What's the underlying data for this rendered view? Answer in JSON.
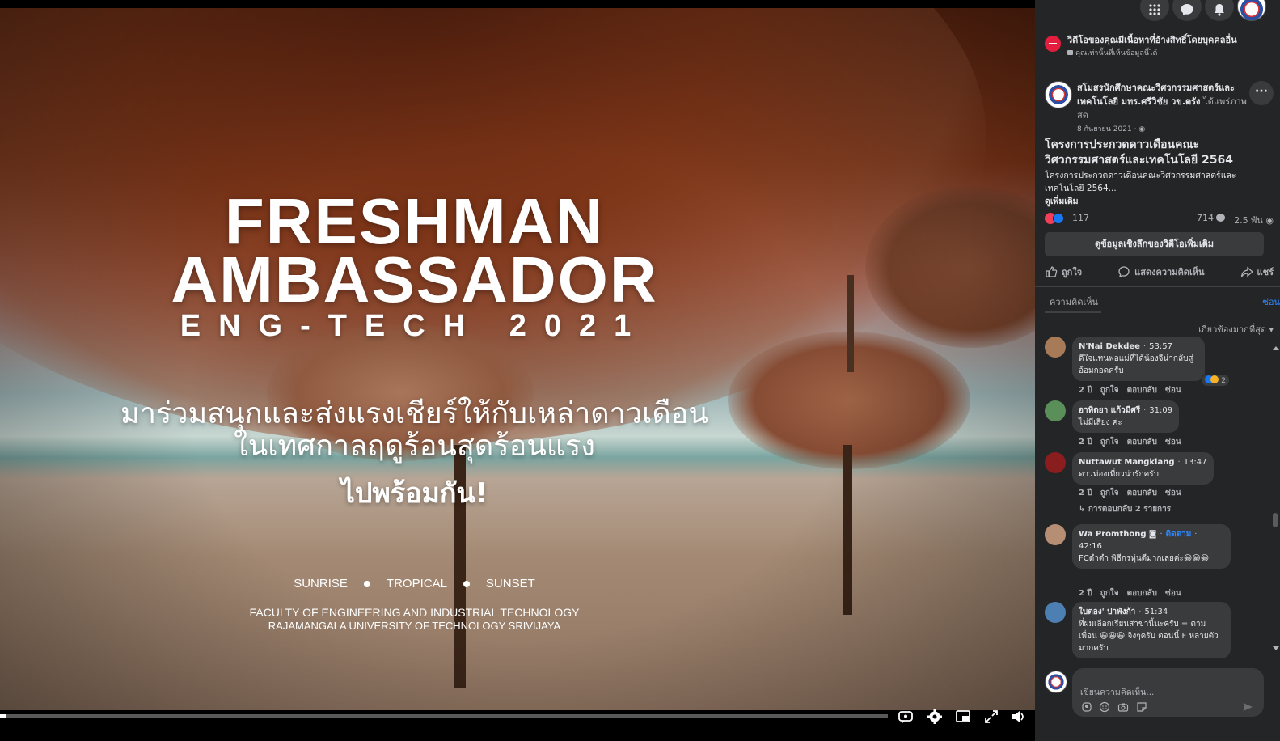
{
  "video": {
    "title_line1": "FRESHMAN",
    "title_line2": "AMBASSADOR",
    "title_line3": "ENG-TECH 2021",
    "thai_line1": "มาร่วมสนุกและส่งแรงเชียร์ให้กับเหล่าดาวเดือน",
    "thai_line2": "ในเทศกาลฤดูร้อนสุดร้อนแรง",
    "thai_line3": "ไปพร้อมกัน!",
    "tags": [
      "SUNRISE",
      "TROPICAL",
      "SUNSET"
    ],
    "faculty_line1": "FACULTY OF ENGINEERING AND INDUSTRIAL TECHNOLOGY",
    "faculty_line2": "RAJAMANGALA UNIVERSITY OF TECHNOLOGY SRIVIJAYA",
    "progress": 0.006,
    "controls": [
      "captions-icon",
      "settings-icon",
      "pip-icon",
      "fullscreen-icon",
      "volume-icon"
    ]
  },
  "side": {
    "warning": {
      "text": "วิดีโอของคุณมีเนื้อหาที่อ้างสิทธิ์โดยบุคคลอื่น",
      "sub": "คุณเท่านั้นที่เห็นข้อมูลนี้ได้"
    },
    "post": {
      "page_name": "สโมสรนักศึกษาคณะวิศวกรรมศาสตร์และเทคโนโลยี มทร.ศรีวิชัย วข.ตรัง",
      "action": "ได้แพร่ภาพสด",
      "date": "8 กันยายน 2021 ·",
      "more": "···",
      "title": "โครงการประกวดดาวเดือนคณะวิศวกรรมศาสตร์และเทคโนโลยี 2564",
      "description": "โครงการประกวดดาวเดือนคณะวิศวกรรมศาสตร์และเทคโนโลยี 2564...",
      "see_more": "ดูเพิ่มเติม",
      "reactions": "117",
      "comments": "714",
      "views": "2.5 พัน",
      "insights_button": "ดูข้อมูลเชิงลึกของวิดีโอเพิ่มเติม",
      "actions": [
        "ถูกใจ",
        "แสดงความคิดเห็น",
        "แชร์"
      ]
    },
    "comments_tab": "ความคิดเห็น",
    "hide_label": "ซ่อน",
    "sort_label": "เกี่ยวข้องมากที่สุด",
    "comments": [
      {
        "name": "N'Nai Dekdee",
        "time": "53:57",
        "text": "ดีใจแทนพ่อแม่ที่ได้น้องจีน่ากลับสู่อ้อมกอดครับ",
        "age": "2 ปี",
        "reaction_count": "2"
      },
      {
        "name": "อาทิตยา แก้วมีศรี",
        "time": "31:09",
        "text": "ไม่มีเสียง ค่ะ",
        "age": "2 ปี"
      },
      {
        "name": "Nuttawut Mangklang",
        "time": "13:47",
        "text": "ดาวท่องเที่ยวน่ารักครับ",
        "age": "2 ปี"
      },
      {
        "name": "Wa Promthong",
        "follow": "ติดตาม",
        "time": "42:16",
        "text": "FCดำดำ พิธีกรหุ่นดีมากเลยค่ะ😀😀😀",
        "age": "2 ปี"
      },
      {
        "name": "ใบตอง' ปาพังก้า",
        "time": "51:34",
        "text": "ที่ผมเลือกเรียนสาขานี้นะครับ = ตามเพื่อน 😀😀😀 จิงๆครับ ตอนนี้ F หลายตัวมากครับ"
      }
    ],
    "comment_actions": {
      "like": "ถูกใจ",
      "reply": "ตอบกลับ",
      "hide": "ซ่อน"
    },
    "replies_link": "การตอบกลับ 2 รายการ",
    "composer_placeholder": "เขียนความคิดเห็น..."
  },
  "colors": {
    "panel_bg": "#242526",
    "bubble_bg": "#3a3b3c",
    "link": "#2d88ff",
    "warning": "#e41e3f"
  }
}
